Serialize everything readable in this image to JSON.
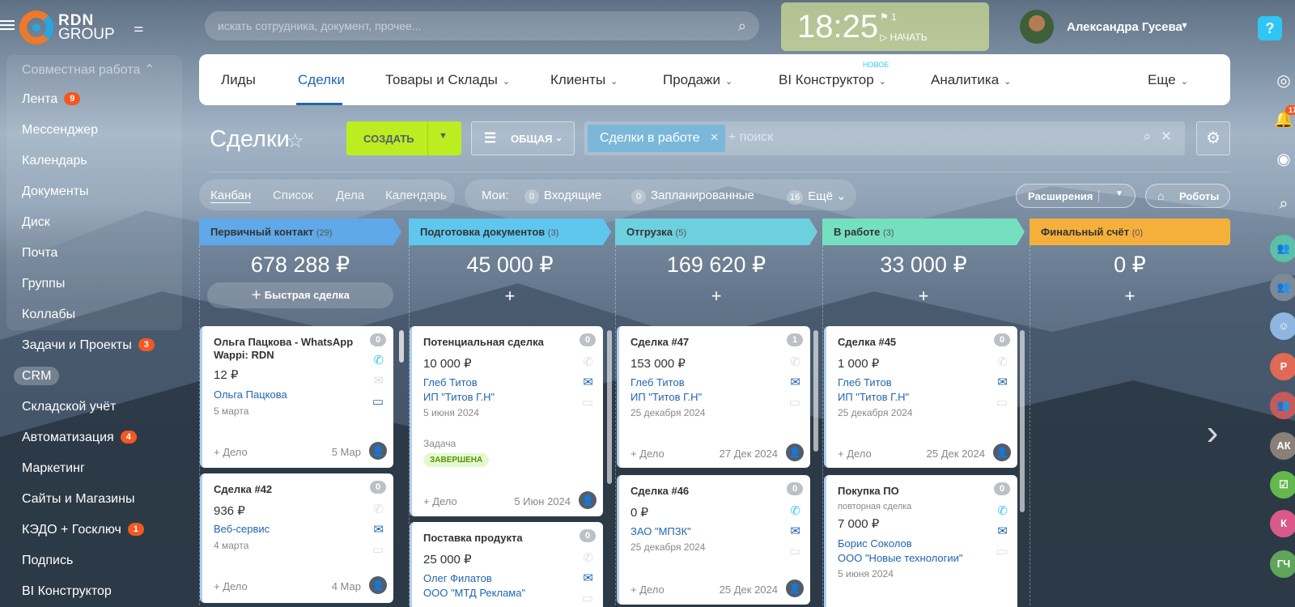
{
  "brand": {
    "name_top": "RDN",
    "name_bottom": "GROUP"
  },
  "search": {
    "placeholder": "искать сотрудника, документ, прочее..."
  },
  "clock": {
    "time": "18:25",
    "flags": "⚑ 1",
    "start": "НАЧАТЬ"
  },
  "user": {
    "name": "Александра Гусева"
  },
  "help": {
    "label": "?"
  },
  "left_menu": {
    "header": "Совместная работа",
    "items": [
      {
        "label": "Лента",
        "badge": "9"
      },
      {
        "label": "Мессенджер",
        "badge": ""
      },
      {
        "label": "Календарь",
        "badge": ""
      },
      {
        "label": "Документы",
        "badge": ""
      },
      {
        "label": "Диск",
        "badge": ""
      },
      {
        "label": "Почта",
        "badge": ""
      },
      {
        "label": "Группы",
        "badge": ""
      },
      {
        "label": "Коллабы",
        "badge": ""
      },
      {
        "label": "Задачи и Проекты",
        "badge": "3"
      },
      {
        "label": "CRM",
        "badge": ""
      },
      {
        "label": "Складской учёт",
        "badge": ""
      },
      {
        "label": "Автоматизация",
        "badge": "4"
      },
      {
        "label": "Маркетинг",
        "badge": ""
      },
      {
        "label": "Сайты и Магазины",
        "badge": ""
      },
      {
        "label": "КЭДО + Госключ",
        "badge": "1"
      },
      {
        "label": "Подпись",
        "badge": ""
      },
      {
        "label": "BI Конструктор",
        "badge": ""
      }
    ]
  },
  "nav": {
    "new_label": "новое",
    "items": [
      "Лиды",
      "Сделки",
      "Товары и Склады",
      "Клиенты",
      "Продажи",
      "BI Конструктор",
      "Аналитика",
      "Еще"
    ]
  },
  "page": {
    "title": "Сделки"
  },
  "toolbar": {
    "create": "СОЗДАТЬ",
    "filter": "ОБЩАЯ",
    "filter_chip": "Сделки в работе",
    "search_placeholder": "+ поиск",
    "extensions": "Расширения",
    "robots": "Роботы"
  },
  "views": [
    "Канбан",
    "Список",
    "Дела",
    "Календарь"
  ],
  "counters": {
    "mine": "Мои:",
    "incoming_count": "0",
    "incoming": "Входящие",
    "planned_count": "0",
    "planned": "Запланированные",
    "more_count": "16",
    "more": "Ещё"
  },
  "kanban": {
    "columns": [
      {
        "title": "Первичный контакт",
        "count": "(29)",
        "sum": "678 288 ₽",
        "quick": "Быстрая сделка",
        "color": "#5fa9e8"
      },
      {
        "title": "Подготовка документов",
        "count": "(3)",
        "sum": "45 000 ₽",
        "quick": "+",
        "color": "#5fc7ee"
      },
      {
        "title": "Отгрузка",
        "count": "(5)",
        "sum": "169 620 ₽",
        "quick": "+",
        "color": "#6dd0de"
      },
      {
        "title": "В работе",
        "count": "(3)",
        "sum": "33 000 ₽",
        "quick": "+",
        "color": "#75e0bf"
      },
      {
        "title": "Финальный счёт",
        "count": "(0)",
        "sum": "0 ₽",
        "quick": "+",
        "color": "#f5b03c"
      }
    ],
    "cards": {
      "c1": {
        "name": "Ольга Пацкова - WhatsApp Wappi: RDN",
        "count": "0",
        "amount": "12 ₽",
        "contact": "Ольга Пацкова",
        "date": "5 марта",
        "add": "+ Дело",
        "deadline": "5 Мар"
      },
      "c2": {
        "name": "Сделка #42",
        "count": "0",
        "amount": "936 ₽",
        "contact": "Веб-сервис",
        "date": "4 марта",
        "add": "+ Дело",
        "deadline": "4 Мар"
      },
      "c3": {
        "name": "Потенциальная сделка",
        "count": "0",
        "amount": "10 000 ₽",
        "contact": "Глеб Титов",
        "company": "ИП \"Титов Г.Н\"",
        "date": "5 июня 2024",
        "task": "Задача",
        "task_status": "ЗАВЕРШЕНА",
        "add": "+ Дело",
        "deadline": "5 Июн 2024"
      },
      "c4": {
        "name": "Поставка продукта",
        "count": "0",
        "amount": "25 000 ₽",
        "contact": "Олег Филатов",
        "company": "ООО \"МТД Реклама\""
      },
      "c5": {
        "name": "Сделка #47",
        "count": "1",
        "amount": "153 000 ₽",
        "contact": "Глеб Титов",
        "company": "ИП \"Титов Г.Н\"",
        "date": "25 декабря 2024",
        "add": "+ Дело",
        "deadline": "27 Дек 2024"
      },
      "c6": {
        "name": "Сделка #46",
        "count": "0",
        "amount": "0 ₽",
        "contact": "ЗАО \"МПЗК\"",
        "date": "25 декабря 2024",
        "add": "+ Дело",
        "deadline": "25 Дек 2024"
      },
      "c7": {
        "name": "Сделка #45",
        "count": "0",
        "amount": "1 000 ₽",
        "contact": "Глеб Титов",
        "company": "ИП \"Титов Г.Н\"",
        "date": "25 декабря 2024",
        "add": "+ Дело",
        "deadline": "25 Дек 2024"
      },
      "c8": {
        "name": "Покупка ПО",
        "count": "0",
        "sub": "повторная сделка",
        "amount": "7 000 ₽",
        "contact": "Борис Соколов",
        "company": "ООО \"Новые технологии\"",
        "date": "5 июня 2024"
      }
    }
  },
  "right_bar": {
    "notif_count": "17",
    "avatars": [
      "Р",
      "АК",
      "К",
      "ГЧ"
    ]
  }
}
